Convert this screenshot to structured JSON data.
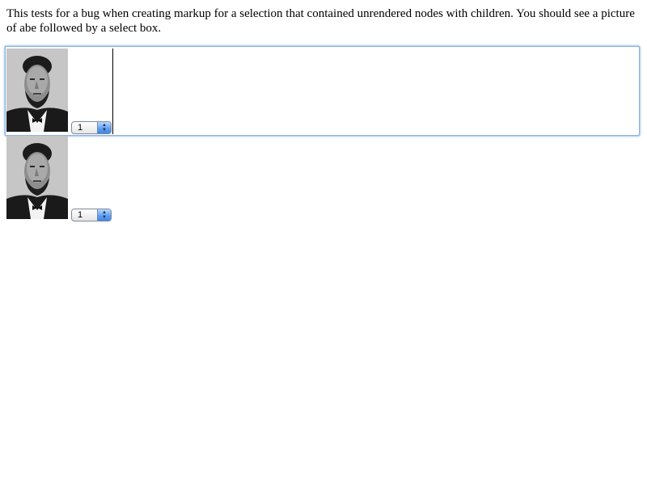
{
  "description": "This tests for a bug when creating markup for a selection that contained unrendered nodes with children. You should see a picture of abe followed by a select box.",
  "editable_region": {
    "image_name": "abe-portrait",
    "select_value": "1"
  },
  "pasted_copy": {
    "image_name": "abe-portrait",
    "select_value": "1"
  },
  "colors": {
    "focus_ring": "#8fb2dd",
    "select_arrow_accent": "#5b9cf0"
  },
  "icons": {
    "select_arrows": "up-down-arrows-icon"
  }
}
